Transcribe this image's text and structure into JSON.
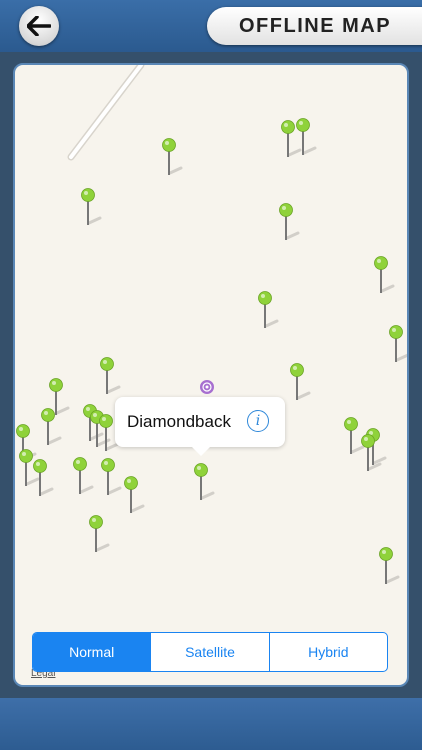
{
  "header": {
    "back_icon": "arrow-left-icon",
    "title": "OFFLINE MAP"
  },
  "map": {
    "pin_color": "#8fd23a",
    "user_location_color": "#9b59b6",
    "callout": {
      "title": "Diamondback",
      "info_icon": "info-icon",
      "info_glyph": "i"
    },
    "legal_label": "Legal"
  },
  "map_type": {
    "options": [
      "Normal",
      "Satellite",
      "Hybrid"
    ],
    "selected": "Normal",
    "accent_color": "#1a84f1"
  }
}
